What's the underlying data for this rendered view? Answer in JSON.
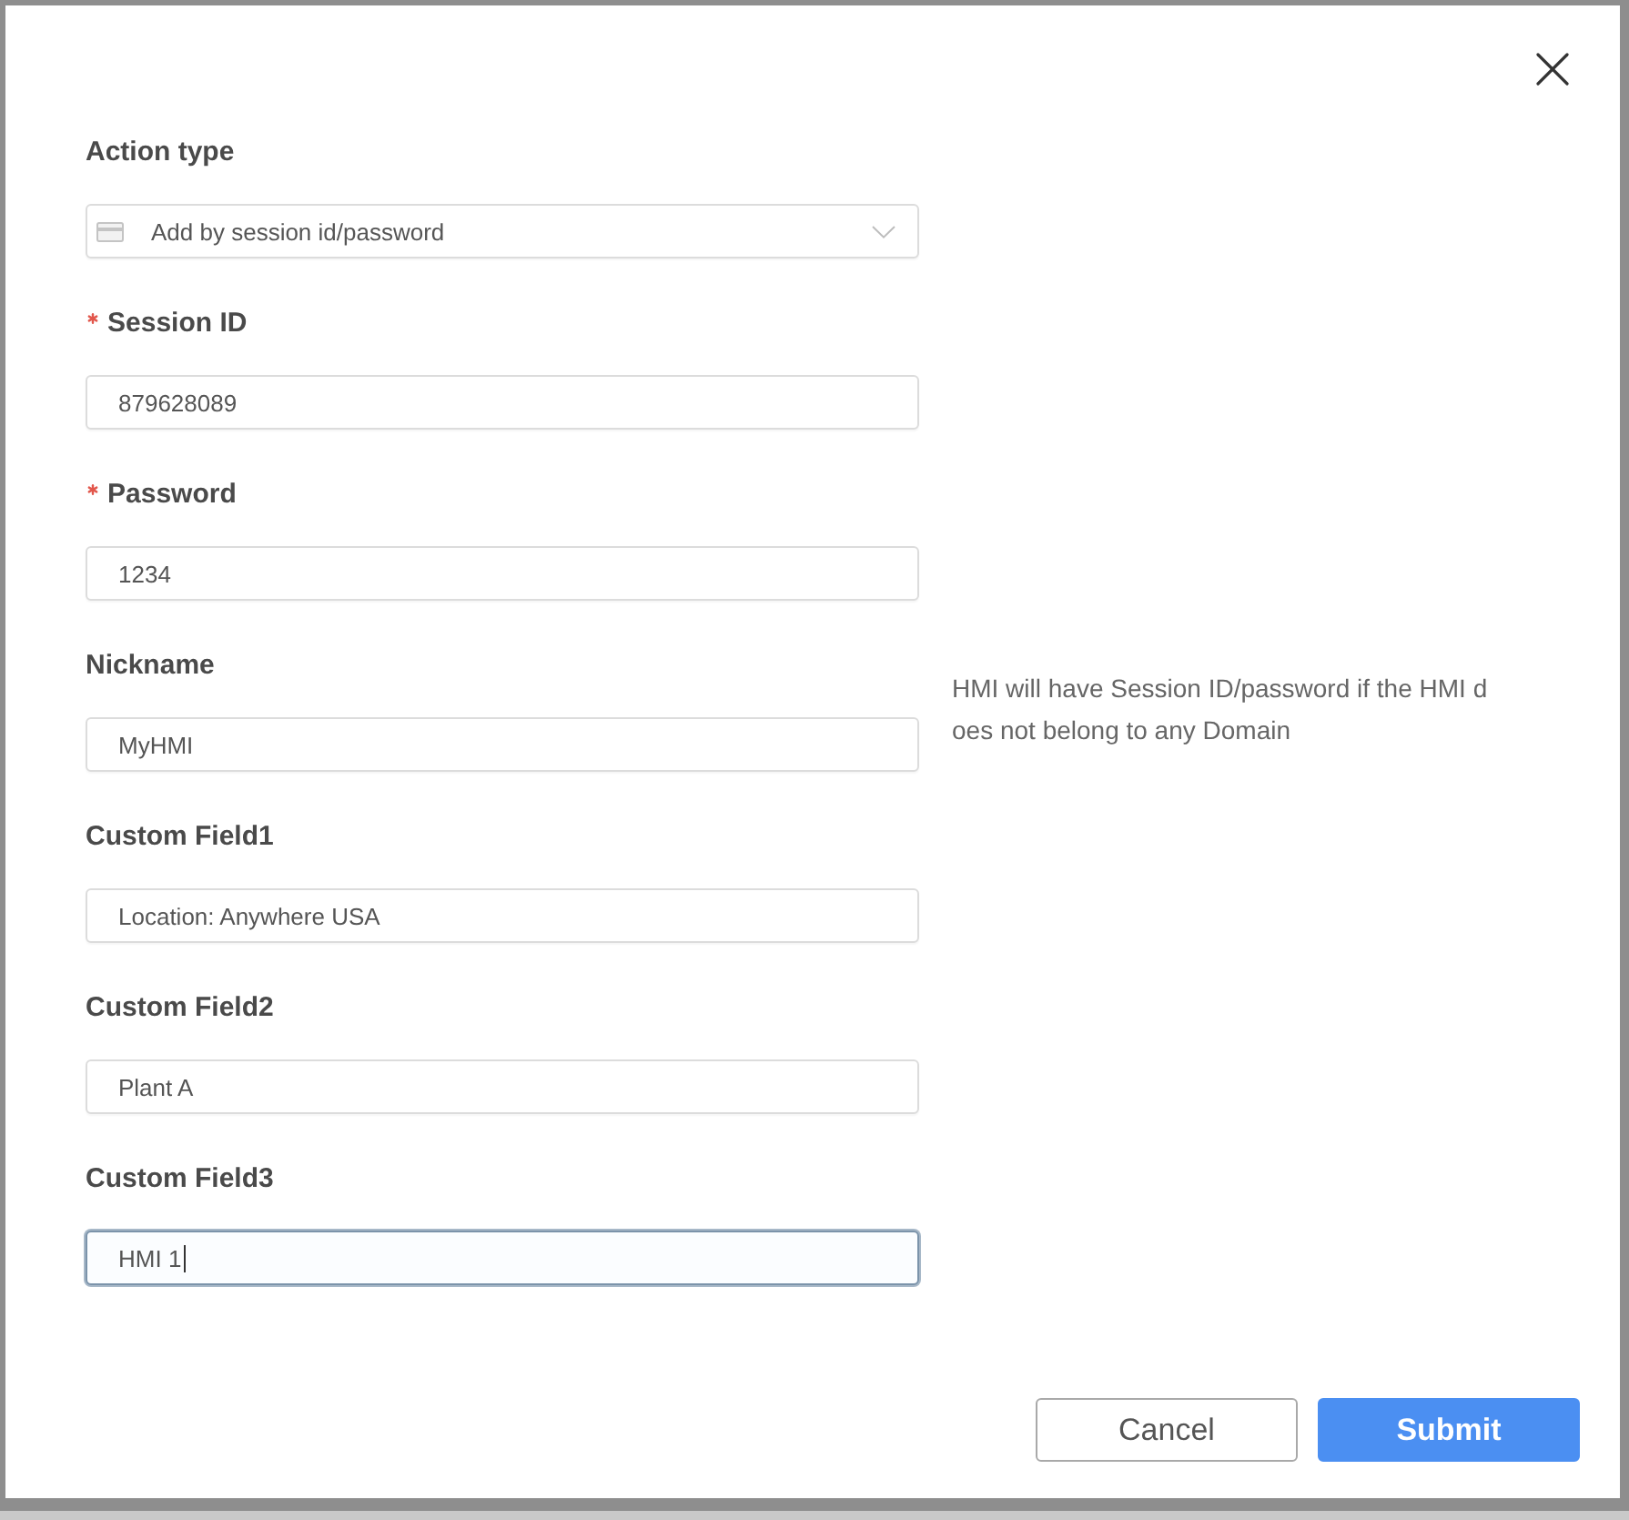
{
  "fields": [
    {
      "kind": "select",
      "label": "Action type",
      "required": false,
      "focused": false,
      "value": "Add by session id/password"
    },
    {
      "kind": "text",
      "label": "Session ID",
      "required": true,
      "focused": false,
      "value": "879628089"
    },
    {
      "kind": "text",
      "label": "Password",
      "required": true,
      "focused": false,
      "value": "1234"
    },
    {
      "kind": "text",
      "label": "Nickname",
      "required": false,
      "focused": false,
      "value": "MyHMI"
    },
    {
      "kind": "text",
      "label": "Custom Field1",
      "required": false,
      "focused": false,
      "value": "Location: Anywhere USA"
    },
    {
      "kind": "text",
      "label": "Custom Field2",
      "required": false,
      "focused": false,
      "value": "Plant A"
    },
    {
      "kind": "text",
      "label": "Custom Field3",
      "required": false,
      "focused": true,
      "value": "HMI 1"
    }
  ],
  "help_text": {
    "lines": [
      "HMI will have Session ID/password if the HMI d",
      "oes not belong to any Domain"
    ]
  },
  "buttons": [
    {
      "kind": "secondary",
      "label": "Cancel"
    },
    {
      "kind": "primary",
      "label": "Submit"
    }
  ]
}
